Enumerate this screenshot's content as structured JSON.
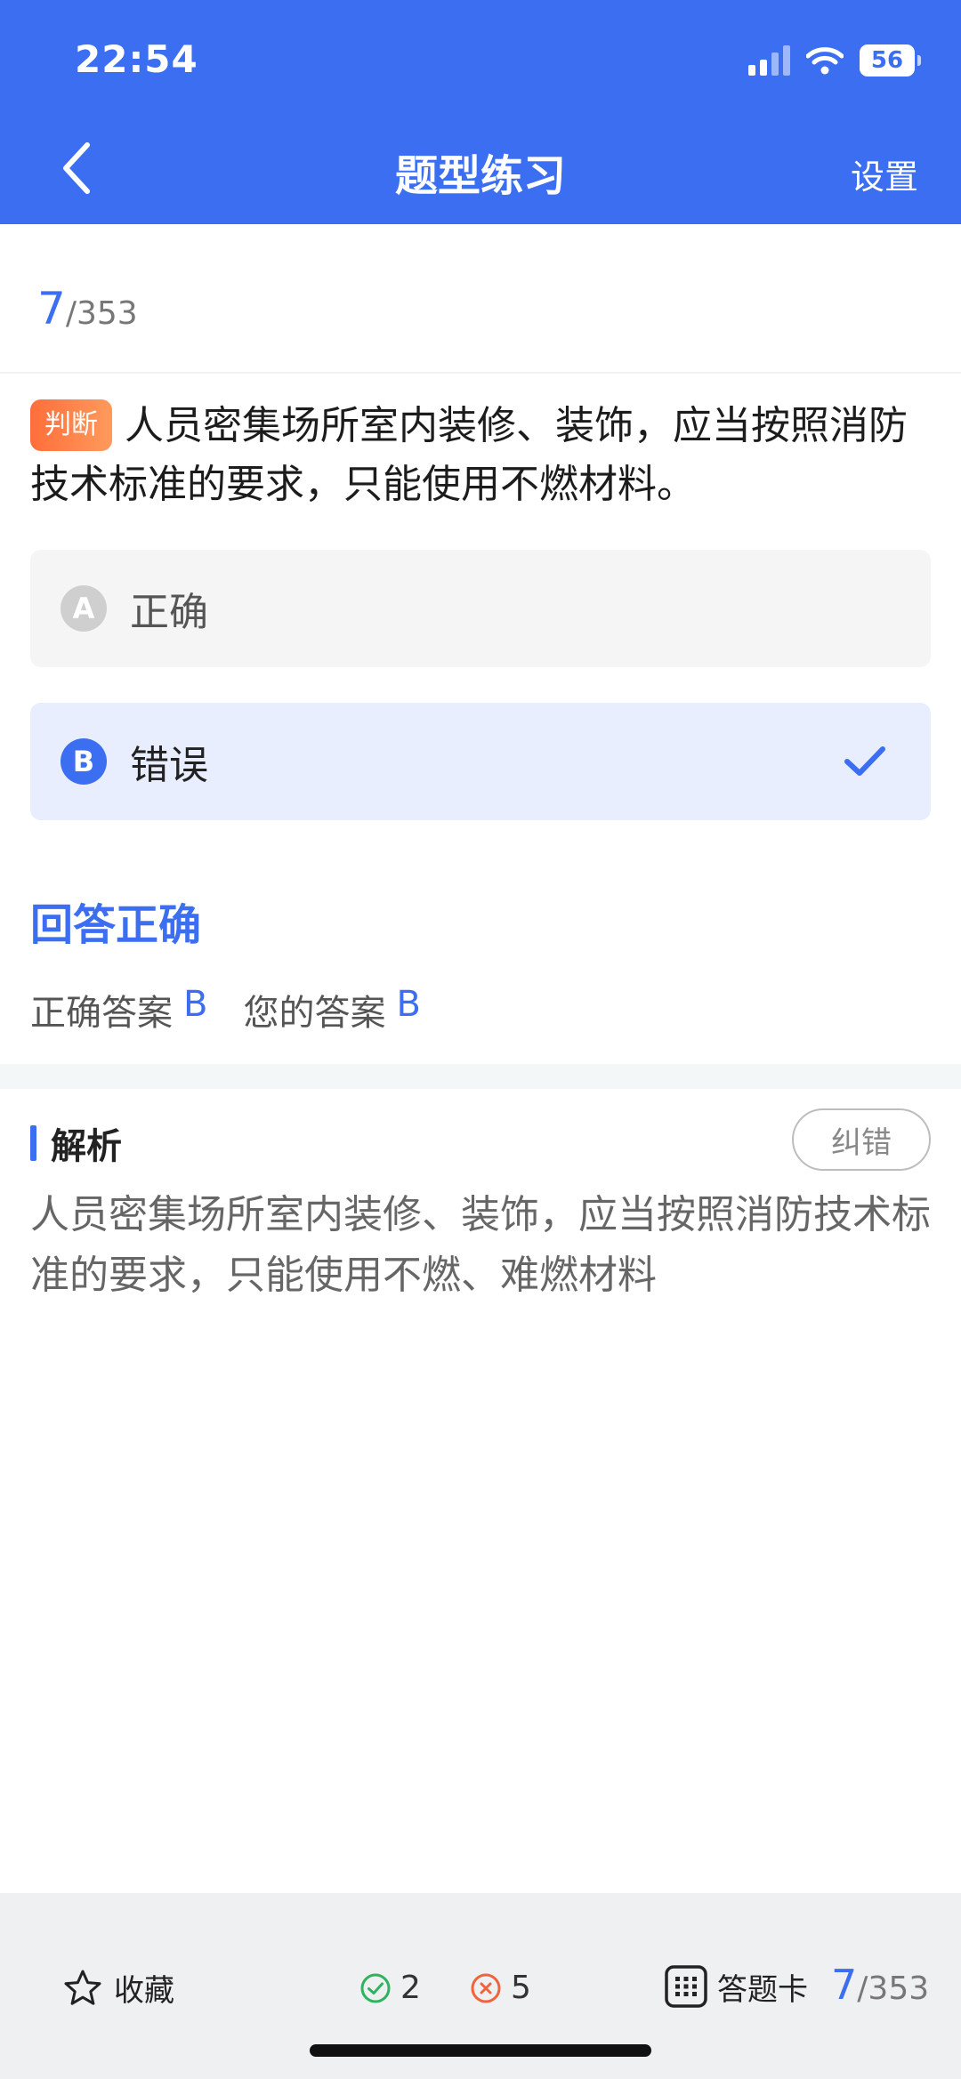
{
  "status_bar": {
    "time": "22:54",
    "battery": "56"
  },
  "nav": {
    "title": "题型练习",
    "settings_label": "设置"
  },
  "progress": {
    "current": "7",
    "total": "/353"
  },
  "question": {
    "type_tag": "判断",
    "text": "人员密集场所室内装修、装饰，应当按照消防技术标准的要求，只能使用不燃材料。"
  },
  "options": [
    {
      "letter": "A",
      "text": "正确",
      "selected": false
    },
    {
      "letter": "B",
      "text": "错误",
      "selected": true
    }
  ],
  "result": {
    "title": "回答正确",
    "correct_label": "正确答案",
    "correct_value": "B",
    "yours_label": "您的答案",
    "yours_value": "B"
  },
  "analysis": {
    "title": "解析",
    "report_label": "纠错",
    "text": "人员密集场所室内装修、装饰，应当按照消防技术标准的要求，只能使用不燃、难燃材料"
  },
  "bottom_bar": {
    "favorite_label": "收藏",
    "right_count": "2",
    "wrong_count": "5",
    "answer_card_label": "答题卡",
    "progress_current": "7",
    "progress_total": "/353"
  },
  "colors": {
    "primary": "#3B6EF0",
    "tag": "#FF7A45",
    "right": "#2DB45D",
    "wrong": "#F0643C"
  }
}
